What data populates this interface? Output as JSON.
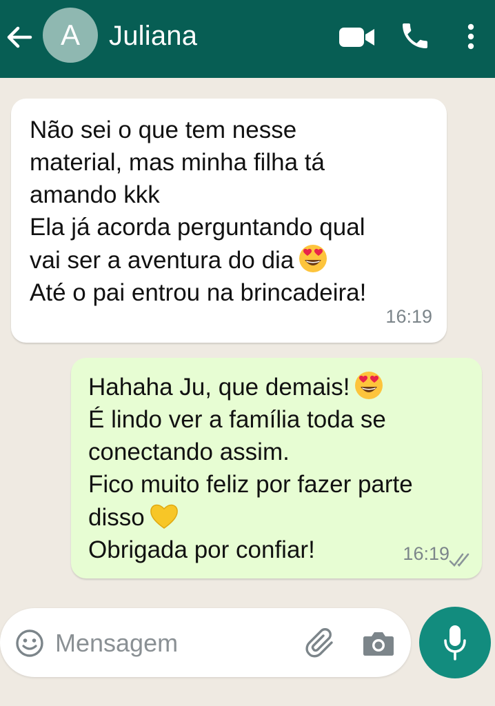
{
  "header": {
    "avatar_letter": "A",
    "contact_name": "Juliana",
    "icons": [
      "arrow-left-icon",
      "video-camera-icon",
      "phone-icon",
      "more-vertical-icon"
    ]
  },
  "messages": [
    {
      "direction": "incoming",
      "lines": [
        "Não sei o que tem nesse",
        "material, mas minha filha tá",
        "amando kkk",
        "Ela já acorda perguntando qual",
        "vai ser a aventura do dia",
        "Até o pai entrou na brincadeira!"
      ],
      "time": "16:19"
    },
    {
      "direction": "outgoing",
      "lines": [
        "Hahaha Ju, que demais!",
        "É lindo ver a família toda se",
        "conectando assim.",
        "Fico muito feliz por fazer parte",
        "disso",
        "Obrigada por confiar!"
      ],
      "time": "16:19",
      "status": "double-check-icon"
    }
  ],
  "composer": {
    "placeholder": "Mensagem",
    "icons": [
      "emoji-icon",
      "paperclip-icon",
      "camera-icon",
      "microphone-icon"
    ]
  },
  "colors": {
    "header": "#075e54",
    "background": "#efeae2",
    "outgoing_bubble": "#e7fdd3",
    "mic_button": "#128c7e"
  }
}
